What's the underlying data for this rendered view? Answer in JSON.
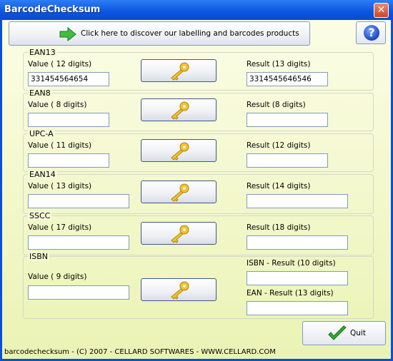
{
  "window": {
    "title": "BarcodeChecksum"
  },
  "banner": {
    "label": "Click here to discover our labelling and barcodes products"
  },
  "help": {
    "glyph": "?"
  },
  "groups": {
    "ean13": {
      "legend": "EAN13",
      "value_label": "Value ( 12 digits)",
      "value": "331454564654",
      "result_label": "Result (13 digits)",
      "result": "3314545646546"
    },
    "ean8": {
      "legend": "EAN8",
      "value_label": "Value ( 8 digits)",
      "value": "",
      "result_label": "Result (8 digits)",
      "result": ""
    },
    "upca": {
      "legend": "UPC-A",
      "value_label": "Value ( 11 digits)",
      "value": "",
      "result_label": "Result (12 digits)",
      "result": ""
    },
    "ean14": {
      "legend": "EAN14",
      "value_label": "Value ( 13 digits)",
      "value": "",
      "result_label": "Result (14 digits)",
      "result": ""
    },
    "sscc": {
      "legend": "SSCC",
      "value_label": "Value ( 17 digits)",
      "value": "",
      "result_label": "Result (18 digits)",
      "result": ""
    },
    "isbn": {
      "legend": "ISBN",
      "value_label": "Value ( 9 digits)",
      "value": "",
      "result_label": "ISBN - Result (10 digits)",
      "result": "",
      "ean_label": "EAN - Result (13 digits)",
      "ean_result": ""
    }
  },
  "quit": {
    "label": "Quit"
  },
  "footer": {
    "text": "barcodechecksum - (C) 2007 - CELLARD SOFTWARES - WWW.CELLARD.COM"
  },
  "colors": {
    "title_bar": "#0b55e0",
    "client_bg": "#f2f7c8",
    "key": "#f2c12e",
    "check": "#2fae2f"
  }
}
